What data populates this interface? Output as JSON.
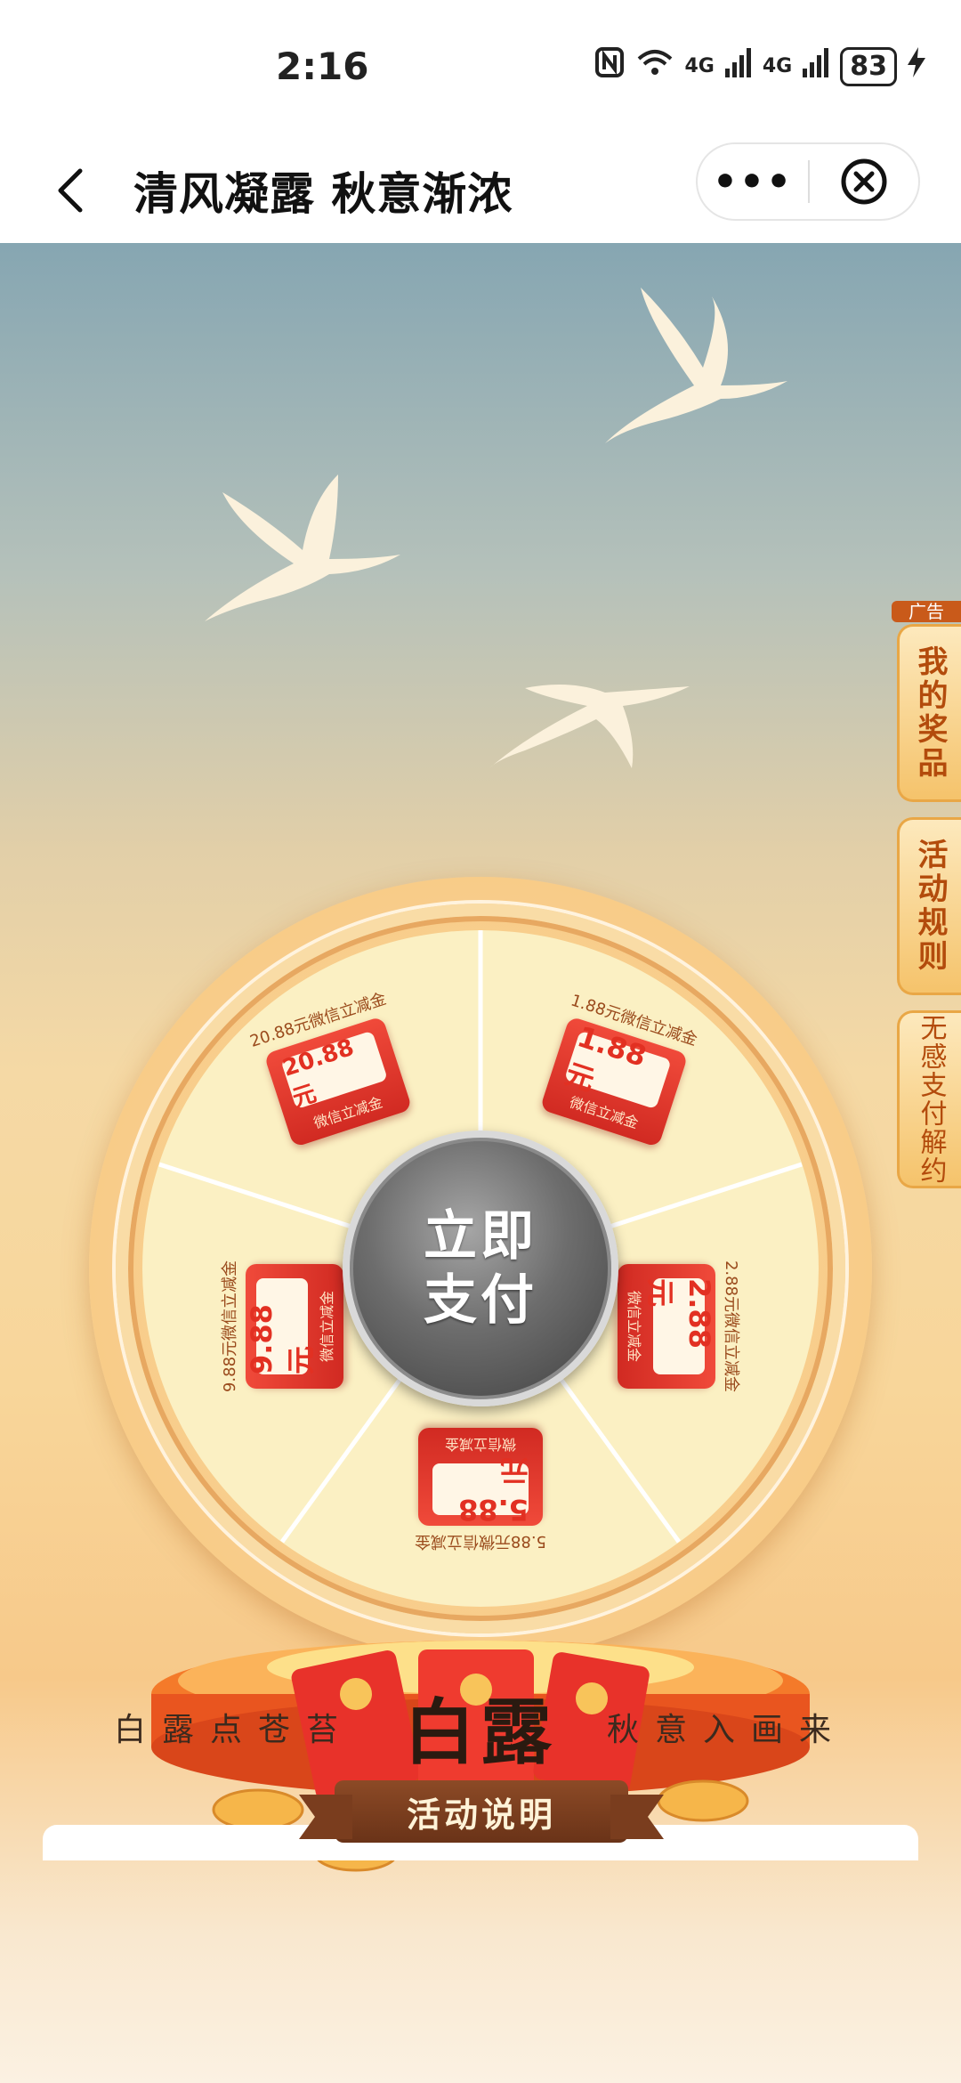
{
  "status_bar": {
    "time": "2:16",
    "network_1": "4G",
    "network_2": "4G",
    "battery": "83"
  },
  "nav": {
    "title": "清风凝露 秋意渐浓",
    "more_label": "•••"
  },
  "side": {
    "ad_tag": "广告",
    "my_prizes": "我的奖品",
    "rules": "活动规则",
    "unbind": "无感支付解约"
  },
  "wheel": {
    "center_line1": "立即",
    "center_line2": "支付",
    "prizes": [
      {
        "title": "20.88元微信立减金",
        "amount": "20.88元",
        "sub": "微信立减金"
      },
      {
        "title": "1.88元微信立减金",
        "amount": "1.88元",
        "sub": "微信立减金"
      },
      {
        "title": "2.88元微信立减金",
        "amount": "2.88元",
        "sub": "微信立减金"
      },
      {
        "title": "5.88元微信立减金",
        "amount": "5.88元",
        "sub": "微信立减金"
      },
      {
        "title": "9.88元微信立减金",
        "amount": "9.88 元",
        "sub": "微信立减金"
      }
    ]
  },
  "slogan": {
    "left": "白露点苍苔",
    "center": "白露",
    "right": "秋意入画来"
  },
  "rules_banner": "活动说明",
  "colors": {
    "accent": "#e23022",
    "side_text": "#b34b0c",
    "banner": "#7a3d1e"
  }
}
